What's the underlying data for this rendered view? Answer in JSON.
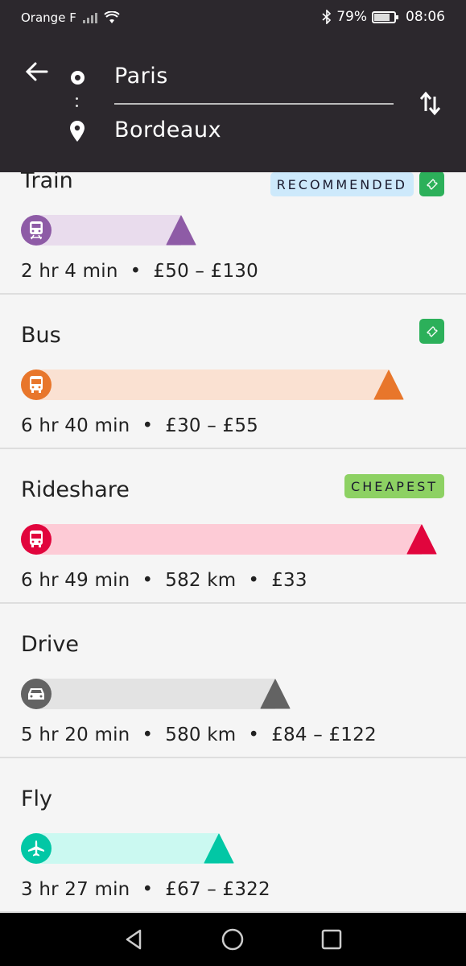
{
  "status_bar": {
    "carrier": "Orange F",
    "battery_percent": "79%",
    "battery_level": 0.79,
    "time": "08:06"
  },
  "header": {
    "origin": "Paris",
    "destination": "Bordeaux"
  },
  "options": [
    {
      "mode": "Train",
      "icon": "train-icon",
      "duration": "2 hr 4 min",
      "details": [
        "£50 – £130"
      ],
      "badge": "RECOMMENDED",
      "ticket": true,
      "color": "#8e5ba6",
      "light_color": "#e9dced",
      "bar_fill_fraction": 0.42
    },
    {
      "mode": "Bus",
      "icon": "bus-icon",
      "duration": "6 hr 40 min",
      "details": [
        "£30 – £55"
      ],
      "badge": "",
      "ticket": true,
      "color": "#e8762b",
      "light_color": "#fae1d2",
      "bar_fill_fraction": 0.915
    },
    {
      "mode": "Rideshare",
      "icon": "rideshare-icon",
      "duration": "6 hr 49 min",
      "details": [
        "582 km",
        "£33"
      ],
      "badge": "CHEAPEST",
      "ticket": false,
      "color": "#e1053d",
      "light_color": "#fdcbd6",
      "bar_fill_fraction": 0.995
    },
    {
      "mode": "Drive",
      "icon": "car-icon",
      "duration": "5 hr 20 min",
      "details": [
        "580 km",
        "£84 – £122"
      ],
      "badge": "",
      "ticket": false,
      "color": "#636363",
      "light_color": "#e3e3e3",
      "bar_fill_fraction": 0.645
    },
    {
      "mode": "Fly",
      "icon": "plane-icon",
      "duration": "3 hr 27 min",
      "details": [
        "£67 – £322"
      ],
      "badge": "",
      "ticket": false,
      "color": "#02c7a5",
      "light_color": "#cbf9f1",
      "bar_fill_fraction": 0.51
    }
  ]
}
